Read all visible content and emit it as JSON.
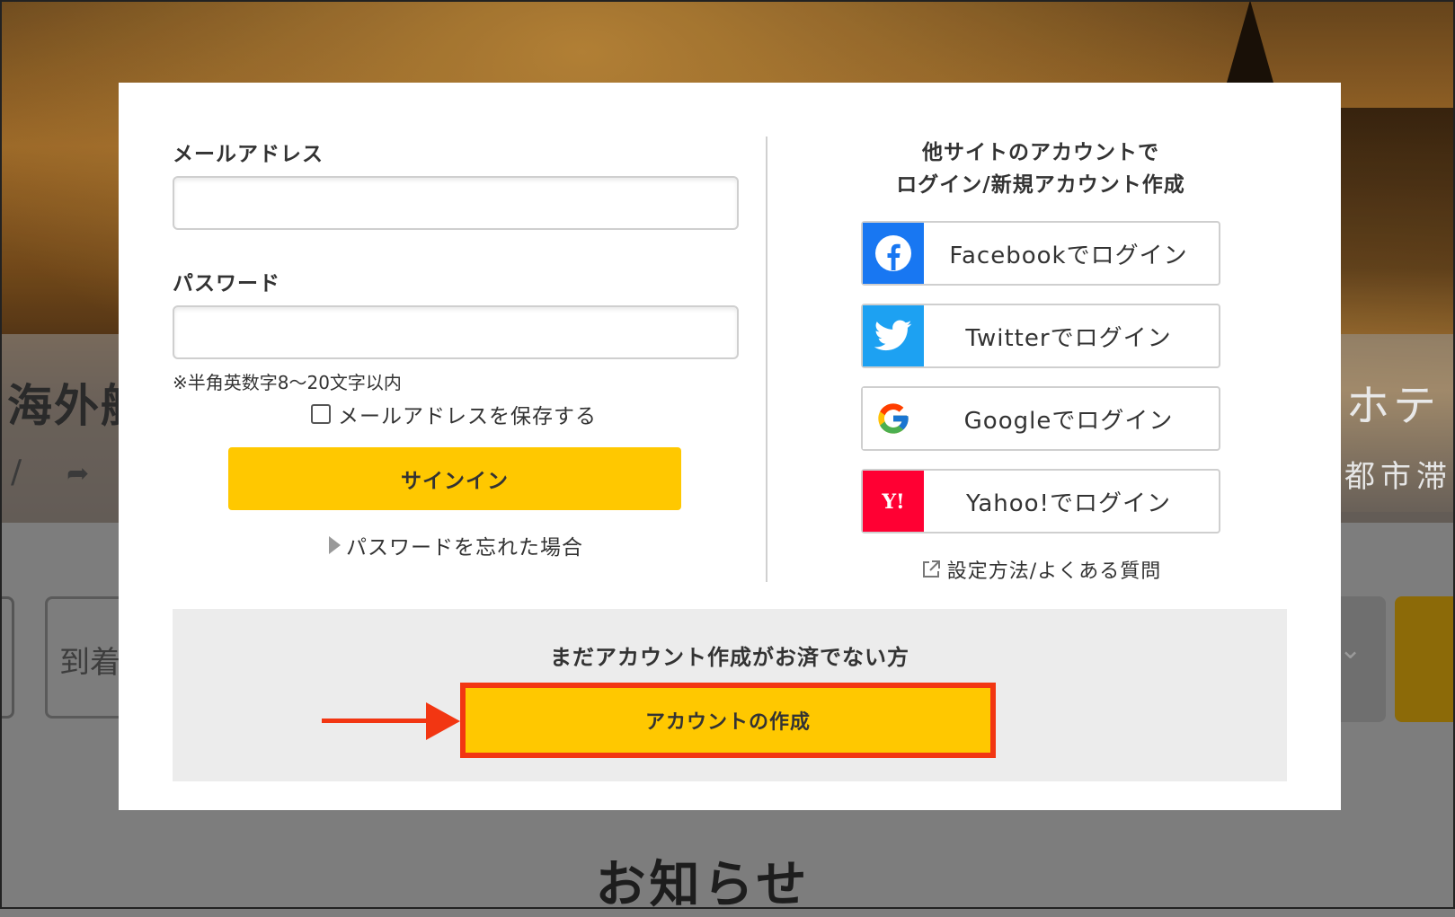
{
  "background": {
    "title_left": "海外航",
    "title_right": "ホテ",
    "sub_left": "/",
    "sub_right": "都市滞",
    "arrival_placeholder": "到着",
    "section_heading": "お知らせ"
  },
  "login": {
    "email_label": "メールアドレス",
    "email_value": "",
    "password_label": "パスワード",
    "password_value": "",
    "password_hint": "※半角英数字8〜20文字以内",
    "remember_label": "メールアドレスを保存する",
    "remember_checked": false,
    "signin_label": "サインイン",
    "forgot_label": "パスワードを忘れた場合"
  },
  "social": {
    "title_line1": "他サイトのアカウントで",
    "title_line2": "ログイン/新規アカウント作成",
    "buttons": [
      {
        "label": "Facebookでログイン",
        "icon": "facebook-icon",
        "color": "#1877f2"
      },
      {
        "label": "Twitterでログイン",
        "icon": "twitter-icon",
        "color": "#1da1f2"
      },
      {
        "label": "Googleでログイン",
        "icon": "google-icon",
        "color": "#ffffff"
      },
      {
        "label": "Yahoo!でログイン",
        "icon": "yahoo-icon",
        "color": "#ff0033"
      }
    ],
    "help_label": "設定方法/よくある質問"
  },
  "register": {
    "title": "まだアカウント作成がお済でない方",
    "button_label": "アカウントの作成"
  },
  "colors": {
    "accent_yellow": "#ffc800",
    "highlight_red": "#f23612"
  }
}
